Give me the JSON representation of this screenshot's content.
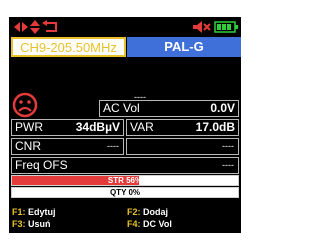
{
  "top_bar": {
    "icons": [
      "arrow-left-right-icon",
      "arrow-up-down-icon",
      "return-icon",
      "speaker-muted-icon",
      "battery-icon"
    ]
  },
  "tabs": {
    "channel": "CH9-205.50MHz",
    "standard": "PAL-G"
  },
  "status": {
    "dashes": "----",
    "lock_icon": "sad-face-icon"
  },
  "measurements": {
    "ac_vol": {
      "label": "AC Vol",
      "value": "0.0V"
    },
    "pwr": {
      "label": "PWR",
      "value": "34dBµV"
    },
    "var": {
      "label": "VAR",
      "value": "17.0dB"
    },
    "cnr": {
      "label": "CNR",
      "value": "----",
      "extra_value": "----"
    },
    "freq_ofs": {
      "label": "Freq OFS",
      "value": "----"
    }
  },
  "bars": {
    "str": {
      "label": "STR 56%",
      "level_percent": 56
    },
    "qty": {
      "label": "QTY 0%",
      "level_percent": 0
    }
  },
  "function_keys": {
    "f1": {
      "key": "F1:",
      "label": "Edytuj"
    },
    "f2": {
      "key": "F2:",
      "label": "Dodaj"
    },
    "f3": {
      "key": "F3:",
      "label": "Usuń"
    },
    "f4": {
      "key": "F4:",
      "label": "DC Vol"
    }
  },
  "colors": {
    "accent_yellow": "#e8c22b",
    "tab_blue": "#3f6fd8",
    "alert_red": "#e33b3b"
  }
}
